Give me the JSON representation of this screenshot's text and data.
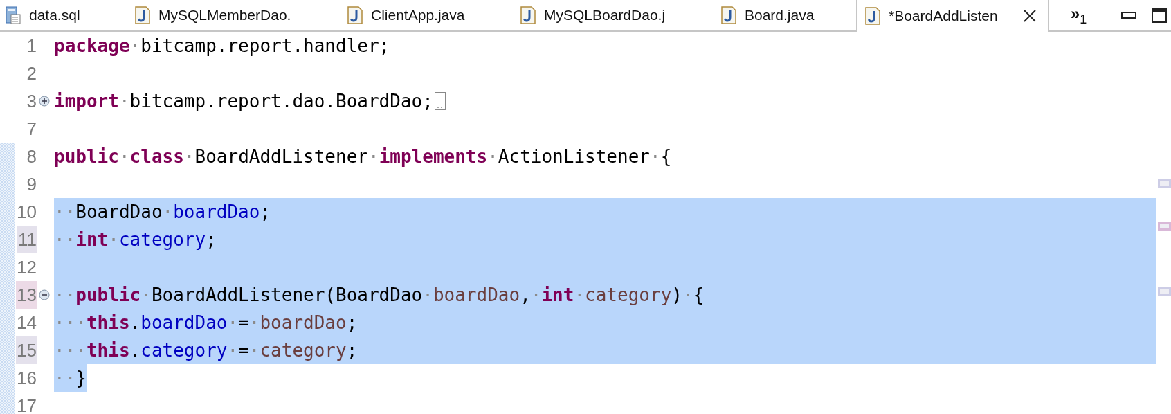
{
  "tabs": [
    {
      "label": "data.sql",
      "kind": "sql",
      "selected": false,
      "closable": false
    },
    {
      "label": "MySQLMemberDao.",
      "kind": "java",
      "selected": false,
      "closable": false
    },
    {
      "label": "ClientApp.java",
      "kind": "java",
      "selected": false,
      "closable": false
    },
    {
      "label": "MySQLBoardDao.j",
      "kind": "java",
      "selected": false,
      "closable": false
    },
    {
      "label": "Board.java",
      "kind": "java",
      "selected": false,
      "closable": false
    },
    {
      "label": "*BoardAddListen",
      "kind": "java",
      "selected": true,
      "closable": true
    }
  ],
  "overflow": "»$_{1}$",
  "view_controls": [
    {
      "kind": "minimize"
    },
    {
      "kind": "maximize"
    }
  ],
  "editor": {
    "lines": [
      {
        "number": "1",
        "selected": false,
        "in_range": false,
        "tokens": [
          {
            "kind": "kw",
            "text": "package"
          },
          {
            "kind": "ws",
            "text": "·"
          },
          {
            "kind": "plain",
            "text": "bitcamp.report.handler;"
          }
        ]
      },
      {
        "number": "2",
        "selected": false,
        "in_range": false
      },
      {
        "number": "3",
        "selected": false,
        "in_range": false,
        "collapsed": true,
        "tokens": [
          {
            "kind": "kw",
            "text": "import"
          },
          {
            "kind": "ws",
            "text": "·"
          },
          {
            "kind": "plain",
            "text": "bitcamp.report.dao.BoardDao;"
          }
        ]
      },
      {
        "number": "7",
        "selected": false,
        "in_range": false
      },
      {
        "number": "8",
        "selected": false,
        "in_range": true,
        "tokens": [
          {
            "kind": "kw",
            "text": "public"
          },
          {
            "kind": "ws",
            "text": "·"
          },
          {
            "kind": "kw",
            "text": "class"
          },
          {
            "kind": "ws",
            "text": "·"
          },
          {
            "kind": "plain",
            "text": "BoardAddListener"
          },
          {
            "kind": "ws",
            "text": "·"
          },
          {
            "kind": "kw",
            "text": "implements"
          },
          {
            "kind": "ws",
            "text": "·"
          },
          {
            "kind": "plain",
            "text": "ActionListener"
          },
          {
            "kind": "ws",
            "text": "·"
          },
          {
            "kind": "plain",
            "text": "{"
          }
        ]
      },
      {
        "number": "9",
        "selected": false,
        "in_range": true
      },
      {
        "number": "10",
        "selected": true,
        "in_range": true,
        "tokens": [
          {
            "kind": "ws",
            "text": "··"
          },
          {
            "kind": "plain",
            "text": "BoardDao"
          },
          {
            "kind": "ws",
            "text": "·"
          },
          {
            "kind": "field",
            "text": "boardDao"
          },
          {
            "kind": "plain",
            "text": ";"
          }
        ]
      },
      {
        "number": "11",
        "selected": true,
        "in_range": true,
        "color": "#e4e1ec",
        "tokens": [
          {
            "kind": "ws",
            "text": "··"
          },
          {
            "kind": "kw",
            "text": "int"
          },
          {
            "kind": "ws",
            "text": "·"
          },
          {
            "kind": "field",
            "text": "category"
          },
          {
            "kind": "plain",
            "text": ";"
          }
        ]
      },
      {
        "number": "12",
        "selected": true,
        "in_range": true
      },
      {
        "number": "13",
        "selected": true,
        "in_range": true,
        "color": "#ecdae6",
        "collapsed": false,
        "tokens": [
          {
            "kind": "ws",
            "text": "··"
          },
          {
            "kind": "kw",
            "text": "public"
          },
          {
            "kind": "ws",
            "text": "·"
          },
          {
            "kind": "plain",
            "text": "BoardAddListener(BoardDao"
          },
          {
            "kind": "ws",
            "text": "·"
          },
          {
            "kind": "param",
            "text": "boardDao"
          },
          {
            "kind": "plain",
            "text": ","
          },
          {
            "kind": "ws",
            "text": "·"
          },
          {
            "kind": "kw",
            "text": "int"
          },
          {
            "kind": "ws",
            "text": "·"
          },
          {
            "kind": "param",
            "text": "category"
          },
          {
            "kind": "plain",
            "text": ")"
          },
          {
            "kind": "ws",
            "text": "·"
          },
          {
            "kind": "plain",
            "text": "{"
          }
        ]
      },
      {
        "number": "14",
        "selected": true,
        "in_range": true,
        "tokens": [
          {
            "kind": "ws",
            "text": "···"
          },
          {
            "kind": "kw",
            "text": "this"
          },
          {
            "kind": "plain",
            "text": "."
          },
          {
            "kind": "field",
            "text": "boardDao"
          },
          {
            "kind": "ws",
            "text": "·"
          },
          {
            "kind": "plain",
            "text": "="
          },
          {
            "kind": "ws",
            "text": "·"
          },
          {
            "kind": "param",
            "text": "boardDao"
          },
          {
            "kind": "plain",
            "text": ";"
          }
        ]
      },
      {
        "number": "15",
        "selected": true,
        "in_range": true,
        "color": "#e4e1ec",
        "tokens": [
          {
            "kind": "ws",
            "text": "···"
          },
          {
            "kind": "kw",
            "text": "this"
          },
          {
            "kind": "plain",
            "text": "."
          },
          {
            "kind": "field",
            "text": "category"
          },
          {
            "kind": "ws",
            "text": "·"
          },
          {
            "kind": "plain",
            "text": "="
          },
          {
            "kind": "ws",
            "text": "·"
          },
          {
            "kind": "param",
            "text": "category"
          },
          {
            "kind": "plain",
            "text": ";"
          }
        ]
      },
      {
        "number": "16",
        "selected": true,
        "partial": true,
        "in_range": true,
        "tokens": [
          {
            "kind": "ws",
            "text": "··"
          },
          {
            "kind": "plain",
            "text": "}"
          }
        ]
      },
      {
        "number": "17",
        "selected": false,
        "in_range": true
      }
    ],
    "overview_marks": [
      {
        "color": "#cdcde6"
      },
      {
        "color": "#d9b8d8"
      },
      {
        "color": "#cdcde6"
      }
    ]
  }
}
